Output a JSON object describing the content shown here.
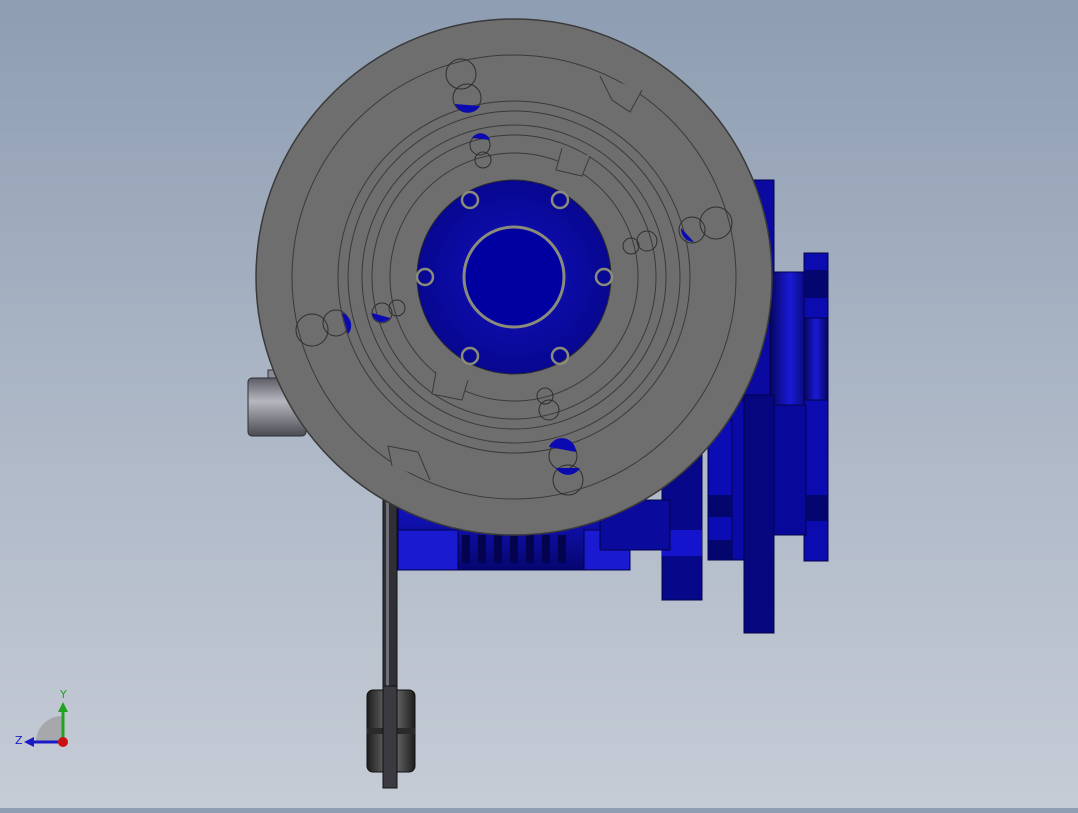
{
  "viewport": {
    "model_colors": {
      "disc_face": "#6f6f6f",
      "disc_edge": "#4a4a4a",
      "body_blue": "#0c0ca6",
      "body_blue_dark": "#07076a",
      "body_blue_light": "#2a2ad6",
      "hub_blue": "#0000a8",
      "shaft_gray": "#8a8a95"
    }
  },
  "triad": {
    "y_label": "Y",
    "z_label": "Z",
    "y_color": "#1fa21f",
    "z_color": "#1a1ac8",
    "x_color": "#cc1111"
  }
}
